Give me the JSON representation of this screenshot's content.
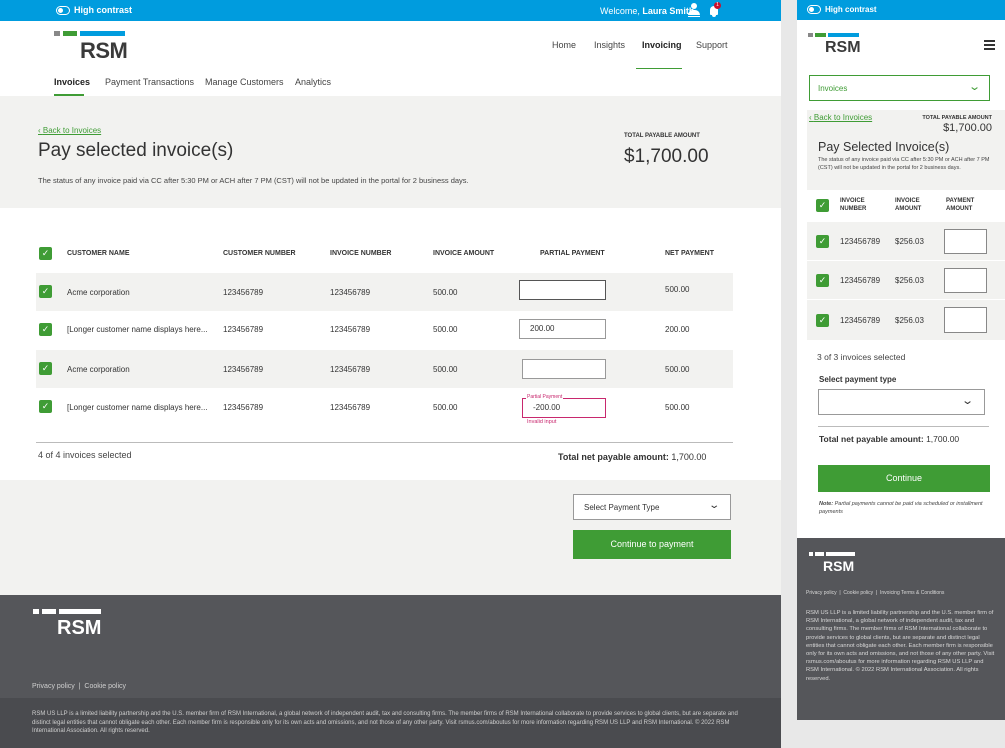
{
  "desktop": {
    "topbar": {
      "high_contrast": "High contrast",
      "welcome": "Welcome,",
      "user": "Laura Smith",
      "notif_count": "1"
    },
    "logo": "RSM",
    "nav": [
      "Home",
      "Insights",
      "Invoicing",
      "Support"
    ],
    "subnav": [
      "Invoices",
      "Payment Transactions",
      "Manage Customers",
      "Analytics"
    ],
    "back": "Back to Invoices",
    "title": "Pay selected invoice(s)",
    "total_label": "TOTAL PAYABLE AMOUNT",
    "total_amount": "$1,700.00",
    "notice": "The status of any invoice paid via CC after 5:30 PM or ACH after 7 PM (CST) will not be updated in the portal for 2 business days.",
    "columns": [
      "CUSTOMER NAME",
      "CUSTOMER NUMBER",
      "INVOICE NUMBER",
      "INVOICE AMOUNT",
      "PARTIAL PAYMENT",
      "NET PAYMENT"
    ],
    "rows": [
      {
        "name": "Acme corporation",
        "cust": "123456789",
        "inv": "123456789",
        "amount": "500.00",
        "partial": "",
        "net": "500.00"
      },
      {
        "name": "[Longer customer name displays here...",
        "cust": "123456789",
        "inv": "123456789",
        "amount": "500.00",
        "partial": "200.00",
        "net": "200.00"
      },
      {
        "name": "Acme corporation",
        "cust": "123456789",
        "inv": "123456789",
        "amount": "500.00",
        "partial": "",
        "net": "500.00"
      },
      {
        "name": "[Longer customer name displays here...",
        "cust": "123456789",
        "inv": "123456789",
        "amount": "500.00",
        "partial": "-200.00",
        "net": "500.00"
      }
    ],
    "partial_label": "Partial Payment",
    "invalid": "Invalid input",
    "selected_count": "4 of 4 invoices selected",
    "total_net_label": "Total net payable amount:",
    "total_net_value": "1,700.00",
    "select_payment": "Select Payment Type",
    "continue": "Continue to payment",
    "footer_links": "Privacy policy  |  Cookie policy",
    "footer_text": "RSM US LLP is a limited liability partnership and the U.S. member firm of RSM International, a global network of independent audit, tax and consulting firms. The member firms of RSM International collaborate to provide services to global clients, but are separate and distinct legal entities that cannot obligate each other. Each member firm is responsible only for its own acts and omissions, and not those of any other party. Visit rsmus.com/aboutus for more information regarding RSM US LLP and RSM International. © 2022 RSM International Association. All rights reserved."
  },
  "mobile": {
    "high_contrast": "High contrast",
    "logo": "RSM",
    "dropdown": "Invoices",
    "back": "Back to Invoices",
    "total_label": "TOTAL PAYABLE AMOUNT",
    "total_amount": "$1,700.00",
    "title": "Pay Selected Invoice(s)",
    "notice": "The status of any invoice paid via CC after 5:30 PM or ACH after 7 PM (CST) will not be updated in the portal for 2 business days.",
    "col1a": "INVOICE",
    "col1b": "NUMBER",
    "col2a": "INVOICE",
    "col2b": "AMOUNT",
    "col3a": "PAYMENT",
    "col3b": "AMOUNT",
    "rows": [
      {
        "inv": "123456789",
        "amount": "$256.03"
      },
      {
        "inv": "123456789",
        "amount": "$256.03"
      },
      {
        "inv": "123456789",
        "amount": "$256.03"
      }
    ],
    "selected": "3 of 3 invoices selected",
    "select_type_label": "Select payment type",
    "total_label2": "Total net payable amount:",
    "total_value": "1,700.00",
    "continue": "Continue",
    "note_bold": "Note:",
    "note": "Partial payments cannot be paid via scheduled or installment payments",
    "footer_links": "Privacy policy  |  Cookie policy  |  Invoicing Terms & Conditions",
    "footer_text": "RSM US LLP is a limited liability partnership and the U.S. member firm of RSM International, a global network of independent audit, tax and consulting firms. The member firms of RSM International collaborate to provide services to global clients, but are separate and distinct legal entities that cannot obligate each other. Each member firm is responsible only for its own acts and omissions, and not those of any other party. Visit rsmus.com/aboutus for more information regarding RSM US LLP and RSM International. © 2022 RSM International Association. All rights reserved."
  }
}
